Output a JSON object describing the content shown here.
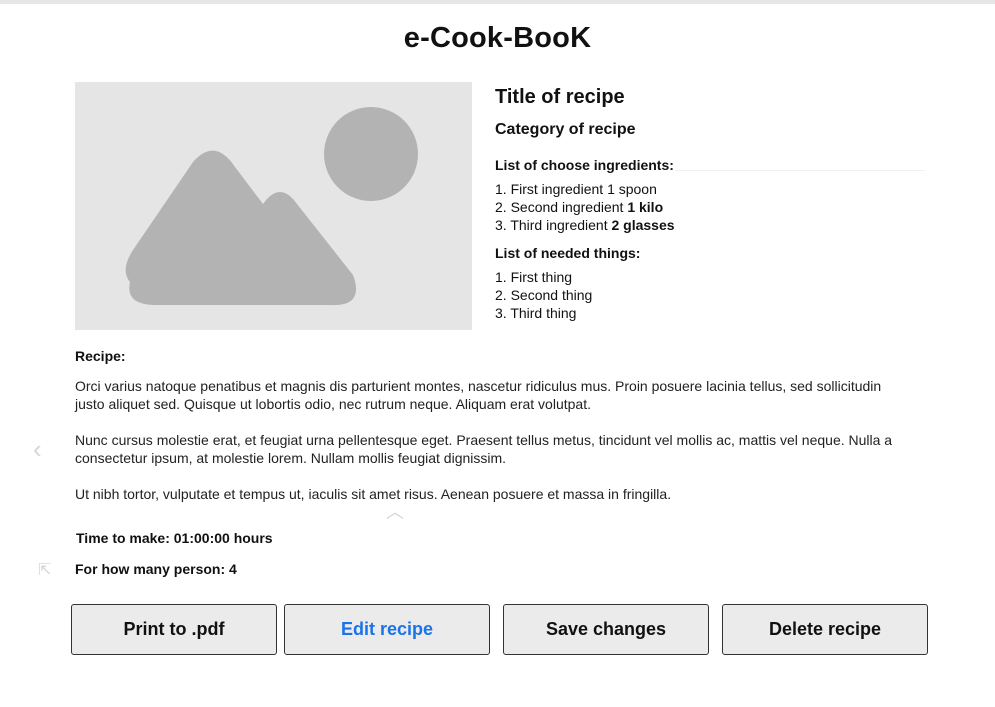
{
  "app": {
    "title": "e-Cook-BooK"
  },
  "recipe": {
    "title": "Title of recipe",
    "category": "Category of recipe",
    "ingredients_heading": "List of choose ingredients:",
    "ingredients": [
      {
        "name": "1. First ingredient ",
        "amount": "1 spoon",
        "amount_bold": false
      },
      {
        "name": "2. Second ingredient ",
        "amount": "1 kilo",
        "amount_bold": true
      },
      {
        "name": "3. Third ingredient ",
        "amount": "2 glasses",
        "amount_bold": true
      }
    ],
    "things_heading": "List of needed things:",
    "things": [
      "1. First thing",
      "2. Second thing",
      "3. Third thing"
    ],
    "recipe_label": "Recipe:",
    "paragraphs": [
      "Orci varius natoque penatibus et magnis dis parturient montes, nascetur ridiculus mus. Proin posuere lacinia tellus, sed sollicitudin justo aliquet sed. Quisque ut lobortis odio, nec rutrum neque. Aliquam erat volutpat.",
      "Nunc cursus molestie erat, et feugiat urna pellentesque eget. Praesent tellus metus, tincidunt vel mollis ac, mattis vel neque. Nulla a consectetur ipsum, at molestie lorem. Nullam mollis feugiat dignissim.",
      "Ut nibh tortor, vulputate et tempus ut, iaculis sit amet risus. Aenean posuere et massa in fringilla."
    ],
    "time_to_make": "Time to make: 01:00:00 hours",
    "persons": "For how many person: 4"
  },
  "image": {
    "icon": "image-placeholder-icon",
    "bg_color": "#e5e5e5",
    "shape_color": "#b3b3b3"
  },
  "buttons": {
    "print": "Print to .pdf",
    "edit": "Edit recipe",
    "save": "Save changes",
    "delete": "Delete recipe"
  },
  "colors": {
    "edit_text": "#1a73e8",
    "button_bg": "#ebebeb"
  }
}
